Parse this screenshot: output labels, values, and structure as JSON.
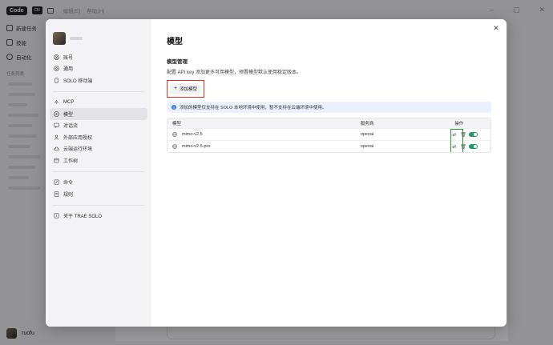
{
  "app": {
    "brand": "Code",
    "brand_badge": "CN",
    "menus": [
      "编辑(E)",
      "帮助(H)"
    ]
  },
  "sidebar": {
    "items": [
      {
        "label": "新建任务"
      },
      {
        "label": "技能"
      },
      {
        "label": "自动化"
      }
    ],
    "section": "任务列表",
    "user": "ruofu"
  },
  "modal": {
    "nav": [
      {
        "label": "账号",
        "icon": "user-circle-icon"
      },
      {
        "label": "通用",
        "icon": "settings-icon"
      },
      {
        "label": "SOLO 移动端",
        "icon": "mobile-icon"
      },
      {
        "label": "MCP",
        "icon": "mcp-icon"
      },
      {
        "label": "模型",
        "icon": "model-icon",
        "active": true
      },
      {
        "label": "对话流",
        "icon": "chat-flow-icon"
      },
      {
        "label": "外部应用授权",
        "icon": "person-icon"
      },
      {
        "label": "云端运行环境",
        "icon": "cloud-icon"
      },
      {
        "label": "工作树",
        "icon": "worktree-icon"
      },
      {
        "label": "命令",
        "icon": "command-icon"
      },
      {
        "label": "规则",
        "icon": "rules-icon"
      },
      {
        "label": "关于 TRAE SOLO",
        "icon": "info-icon"
      }
    ],
    "title": "模型",
    "section_title": "模型管理",
    "section_desc": "配置 API key 添加更多可用模型，预置模型默认使用稳定版本。",
    "add_button": "添加模型",
    "info": "添加的模型仅支持在 SOLO 本地环境中使用，暂不支持在云端环境中使用。",
    "table": {
      "headers": [
        "模型",
        "服务商",
        "操作"
      ],
      "rows": [
        {
          "model": "mimo-v2.5",
          "provider": "openai",
          "enabled": true
        },
        {
          "model": "mimo-v2.5-pro",
          "provider": "openai",
          "enabled": true
        }
      ]
    }
  },
  "colors": {
    "accent_green": "#1f9b62",
    "highlight_red": "#d13a1e",
    "highlight_green": "#2f9a3a",
    "info_blue": "#3a7bed"
  }
}
